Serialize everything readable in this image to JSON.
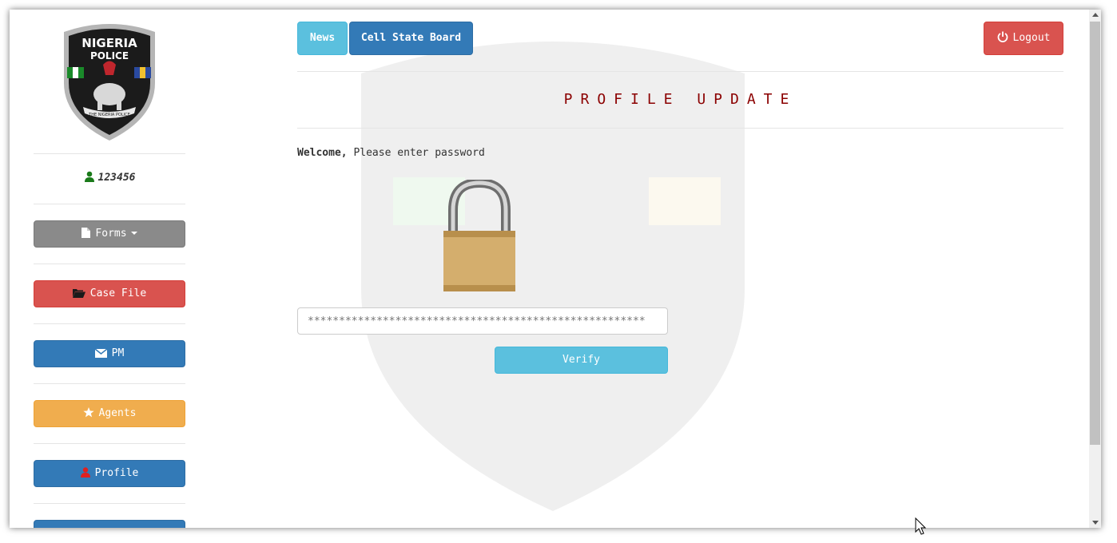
{
  "sidebar": {
    "user_id": "123456",
    "buttons": [
      {
        "label": "Forms",
        "icon": "file-icon"
      },
      {
        "label": "Case File",
        "icon": "folder-open-icon"
      },
      {
        "label": "PM",
        "icon": "envelope-icon"
      },
      {
        "label": "Agents",
        "icon": "star-icon"
      },
      {
        "label": "Profile",
        "icon": "user-icon"
      }
    ]
  },
  "logo": {
    "line1": "NIGERIA",
    "line2": "POLICE",
    "ribbon": "THE NIGERIA POLICE"
  },
  "header": {
    "news": "News",
    "cell_state_board": "Cell State Board",
    "logout": "Logout"
  },
  "main": {
    "title": "PROFILE UPDATE",
    "welcome_bold": "Welcome,",
    "welcome_rest": " Please enter password",
    "password_placeholder": "******************************************************",
    "verify_label": "Verify"
  },
  "colors": {
    "title": "#8b0000",
    "primary": "#337ab7",
    "danger": "#d9534f",
    "info": "#5bc0de",
    "warning": "#f0ad4e"
  }
}
